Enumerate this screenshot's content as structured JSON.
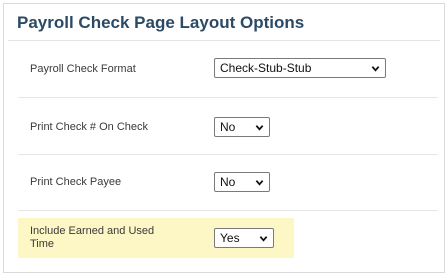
{
  "panel": {
    "title": "Payroll Check Page Layout Options"
  },
  "rows": [
    {
      "label": "Payroll Check Format",
      "value": "Check-Stub-Stub"
    },
    {
      "label": "Print Check # On Check",
      "value": "No"
    },
    {
      "label": "Print Check Payee",
      "value": "No"
    },
    {
      "label_line1": "Include Earned and Used",
      "label_line2": "Time",
      "value": "Yes"
    }
  ],
  "colors": {
    "title": "#2b4a66",
    "highlight": "#fdf6c5",
    "border": "#d9d9d9"
  },
  "icons": {
    "dropdown": "chevron-down-icon"
  }
}
